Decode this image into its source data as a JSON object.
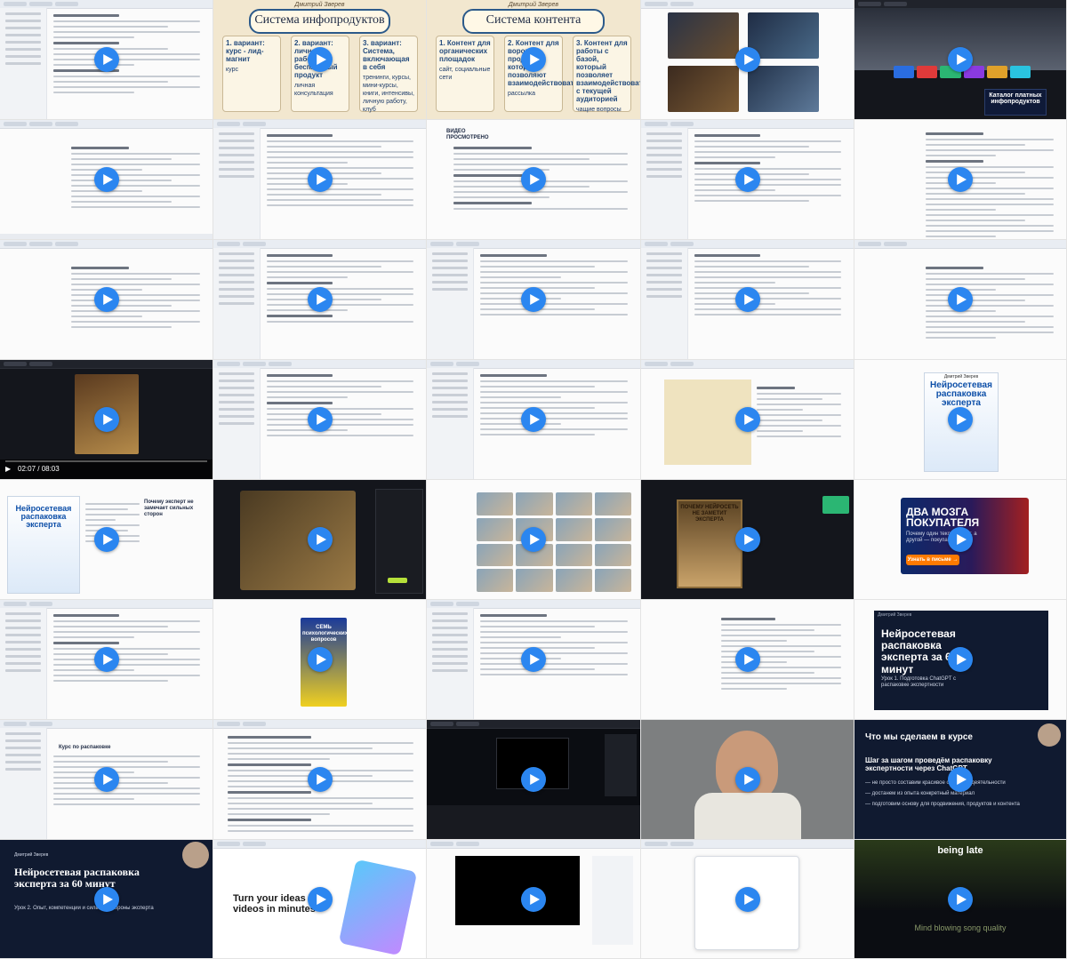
{
  "tiles": {
    "r1c2": {
      "author": "Дмитрий Зверев",
      "title": "Система инфопродуктов",
      "col1": "1. вариант: курс - лид-магнит",
      "col1_item": "курс",
      "col2": "2. вариант: личная работа - бесплатный продукт",
      "col2_item": "личная консультация",
      "col3": "3. вариант: Система, включающая в себя",
      "col3_items": "тренинги, курсы, мини-курсы, книги, интенсивы, личную работу, клуб"
    },
    "r1c3": {
      "author": "Дмитрий Зверев",
      "title": "Система контента",
      "col1": "1. Контент для органических площадок",
      "col1_items": "сайт, социальные сети",
      "col2": "2. Контент для воронок продаж, которые позволяют взаимодействовать",
      "col2_items": "рассылка",
      "col3": "3. Контент для работы с базой, который позволяет взаимодействовать с текущей аудиторией",
      "col3_items": "чащие вопросы"
    },
    "r1c5": {
      "caption": "Каталог платных инфопродуктов"
    },
    "r2c3": {
      "logo": "ВИДЕО ПРОСМОТРЕНО"
    },
    "r4c1": {
      "time": "02:07 / 08:03"
    },
    "r4c5": {
      "author": "Дмитрий Зверев",
      "title": "Нейросетевая распаковка эксперта"
    },
    "r5c1": {
      "title": "Нейросетевая распаковка эксперта",
      "side_heading": "Почему эксперт не замечает сильных сторон"
    },
    "r5c4": {
      "headline": "ПОЧЕМУ НЕЙРОСЕТЬ НЕ ЗАМЕТИТ ЭКСПЕРТА"
    },
    "r5c5": {
      "headline": "ДВА МОЗГА ПОКУПАТЕЛЯ",
      "subline": "Почему один текст читают, а другой — покупают?",
      "cta": "Узнать в письме →"
    },
    "r6c2": {
      "headline": "СЕМЬ психологических вопросов"
    },
    "r6c5": {
      "author": "Дмитрий Зверев",
      "title": "Нейросетевая распаковка эксперта за 60 минут",
      "subtitle": "Урок 1. Подготовка ChatGPT с распаковке экспертности"
    },
    "r7c1": {
      "heading": "Курс по распаковке"
    },
    "r7c5": {
      "title": "Что мы сделаем в курсе",
      "lead": "Шаг за шагом проведём распаковку экспертности через ChatGPT",
      "point1": "— не просто составим красивое описание деятельности",
      "point2": "— достанем из опыта конкретный материал",
      "point3": "— подготовим основу для продвижения, продуктов и контента"
    },
    "r8c1": {
      "author": "Дмитрий Зверев",
      "title": "Нейросетевая распаковка эксперта за 60 минут",
      "subtitle": "Урок 2. Опыт, компетенции и сильные стороны эксперта"
    },
    "r8c2": {
      "headline": "Turn your ideas into videos in minutes"
    },
    "r8c5": {
      "top": "being late",
      "bottom": "Mind blowing song quality"
    }
  },
  "icons": {
    "play": "play-icon"
  },
  "colors": {
    "play_button": "#2b86f0",
    "navy_bg": "#101a30",
    "accent_orange": "#ff7a00"
  }
}
